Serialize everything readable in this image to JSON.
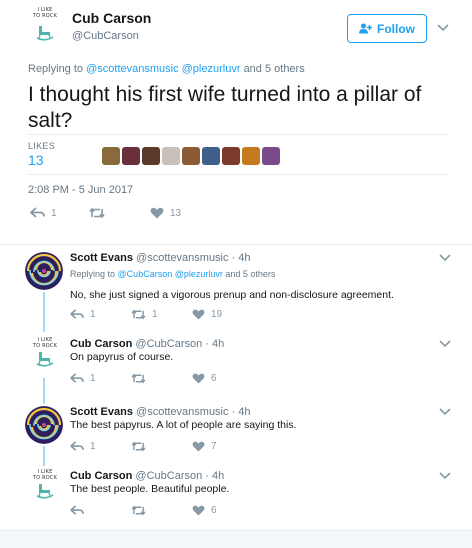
{
  "main_tweet": {
    "avatar_text": "I LIKE\nTO ROCK",
    "author_name": "Cub Carson",
    "author_handle": "@CubCarson",
    "follow_label": "Follow",
    "replying_prefix": "Replying to",
    "replying_users": "@scottevansmusic @plezurluvr",
    "replying_suffix": "and 5 others",
    "text": "I thought his first wife turned into a pillar of salt?",
    "likes_label": "LIKES",
    "likes_count": "13",
    "timestamp": "2:08 PM - 5 Jun 2017",
    "reply_count": "1",
    "retweet_count": "",
    "like_count": "13",
    "liker_avatar_colors": [
      "#8a6a3c",
      "#6b2f3a",
      "#5a3b2a",
      "#c9c0b8",
      "#8c5a34",
      "#3f5e8a",
      "#7b3a2a",
      "#c57a1e",
      "#7a4a8a"
    ]
  },
  "replies": [
    {
      "avatar": "spiral",
      "name": "Scott Evans",
      "handle": "@scottevansmusic",
      "time": "· 4h",
      "replying_prefix": "Replying to",
      "replying_users": "@CubCarson @plezurluvr",
      "replying_suffix": "and 5 others",
      "text": "No, she just signed a vigorous prenup and non-disclosure agreement.",
      "reply_count": "1",
      "retweet_count": "1",
      "like_count": "19"
    },
    {
      "avatar": "rocker",
      "name": "Cub Carson",
      "handle": "@CubCarson",
      "time": "· 4h",
      "text": "On papyrus of course.",
      "reply_count": "1",
      "retweet_count": "",
      "like_count": "6"
    },
    {
      "avatar": "spiral",
      "name": "Scott Evans",
      "handle": "@scottevansmusic",
      "time": "· 4h",
      "text": "The best papyrus. A lot of people are saying this.",
      "reply_count": "1",
      "retweet_count": "",
      "like_count": "7"
    },
    {
      "avatar": "rocker",
      "name": "Cub Carson",
      "handle": "@CubCarson",
      "time": "· 4h",
      "text": "The best people. Beautiful people.",
      "reply_count": "",
      "retweet_count": "",
      "like_count": "6"
    }
  ],
  "colors": {
    "accent": "#1da1f2",
    "muted": "#657786",
    "icon": "#8899a6",
    "thread_line": "#a4d9f9"
  },
  "icons": [
    "reply-icon",
    "retweet-icon",
    "heart-icon",
    "chevron-down-icon",
    "add-user-icon",
    "rocking-chair-icon",
    "spiral-icon"
  ]
}
